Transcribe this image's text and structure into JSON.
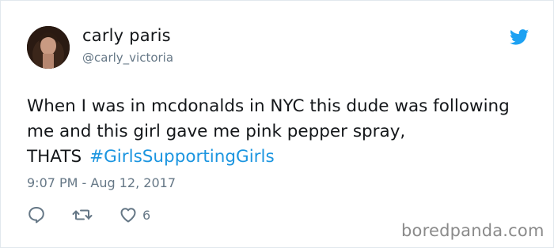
{
  "user": {
    "display_name": "carly paris",
    "handle": "@carly_victoria"
  },
  "tweet": {
    "text": "When I was in mcdonalds in NYC this dude was following me and this girl gave me pink pepper spray, THATS",
    "hashtag": "#GirlsSupportingGirls",
    "timestamp": "9:07 PM - Aug 12, 2017"
  },
  "actions": {
    "like_count": "6"
  },
  "icons": {
    "logo": "twitter-bird-icon",
    "reply": "reply-icon",
    "retweet": "retweet-icon",
    "like": "heart-icon"
  },
  "colors": {
    "twitter_blue": "#1da1f2",
    "hashtag": "#1b95e0",
    "meta": "#657786",
    "text": "#14171a"
  },
  "watermark": "boredpanda.com"
}
